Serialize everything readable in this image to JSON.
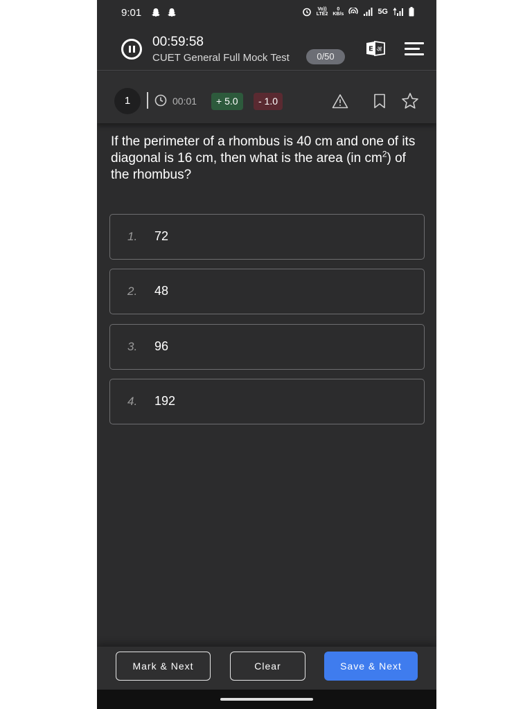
{
  "status_bar": {
    "time": "9:01",
    "lte_top": "Vo))",
    "lte_bottom": "LTE2",
    "kbs_top": "0",
    "kbs_bottom": "KB/s",
    "network": "5G"
  },
  "header": {
    "timer": "00:59:58",
    "test_name": "CUET General Full Mock Test",
    "progress": "0/50",
    "lang_en": "E",
    "lang_hi": "अ"
  },
  "question_meta": {
    "number": "1",
    "time_spent": "00:01",
    "positive_marks": "+ 5.0",
    "negative_marks": "- 1.0"
  },
  "question": {
    "text_before_sup": "If the perimeter of a rhombus is 40 cm and one of its diagonal is 16 cm, then what is the area (in cm",
    "sup": "2",
    "text_after_sup": ") of the rhombus?"
  },
  "options": [
    {
      "num": "1.",
      "text": "72"
    },
    {
      "num": "2.",
      "text": "48"
    },
    {
      "num": "3.",
      "text": "96"
    },
    {
      "num": "4.",
      "text": "192"
    }
  ],
  "actions": {
    "mark_next": "Mark & Next",
    "clear": "Clear",
    "save_next": "Save & Next"
  },
  "colors": {
    "background": "#2c2c2d",
    "primary_button": "#3f7cee",
    "positive_badge": "#2d5a3c",
    "negative_badge": "#5a2a31"
  },
  "icons": [
    "pause-icon",
    "language-toggle-icon",
    "hamburger-menu-icon",
    "clock-icon",
    "warning-icon",
    "bookmark-icon",
    "star-icon"
  ]
}
